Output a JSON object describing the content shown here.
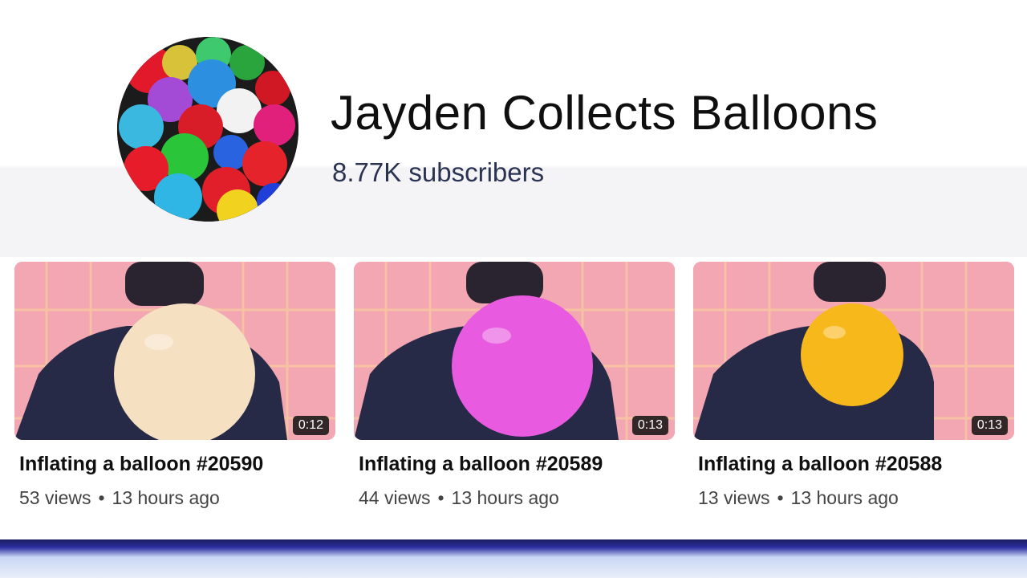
{
  "channel": {
    "name": "Jayden Collects Balloons",
    "subscribers": "8.77K subscribers",
    "avatar_icon": "balloon-pile-avatar"
  },
  "videos": [
    {
      "title": "Inflating a balloon #20590",
      "views": "53 views",
      "separator": "•",
      "age": "13 hours ago",
      "duration": "0:12",
      "balloon_color": "#f6e0c2"
    },
    {
      "title": "Inflating a balloon #20589",
      "views": "44 views",
      "separator": "•",
      "age": "13 hours ago",
      "duration": "0:13",
      "balloon_color": "#e85ae0"
    },
    {
      "title": "Inflating a balloon #20588",
      "views": "13 views",
      "separator": "•",
      "age": "13 hours ago",
      "duration": "0:13",
      "balloon_color": "#f7b81c"
    }
  ],
  "colors": {
    "thumb_background": "#f3a7b2",
    "accent_bottom": "#2c2fa0"
  }
}
